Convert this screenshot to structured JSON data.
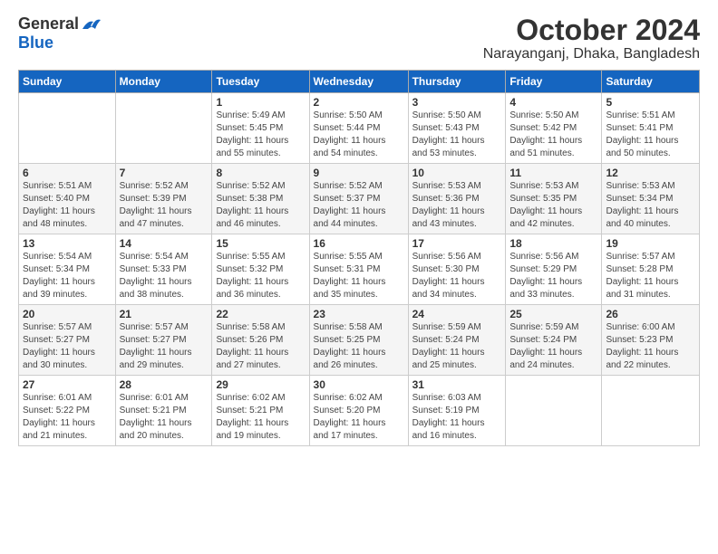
{
  "logo": {
    "general": "General",
    "blue": "Blue"
  },
  "title": "October 2024",
  "location": "Narayanganj, Dhaka, Bangladesh",
  "days_of_week": [
    "Sunday",
    "Monday",
    "Tuesday",
    "Wednesday",
    "Thursday",
    "Friday",
    "Saturday"
  ],
  "weeks": [
    [
      {
        "day": "",
        "info": ""
      },
      {
        "day": "",
        "info": ""
      },
      {
        "day": "1",
        "info": "Sunrise: 5:49 AM\nSunset: 5:45 PM\nDaylight: 11 hours\nand 55 minutes."
      },
      {
        "day": "2",
        "info": "Sunrise: 5:50 AM\nSunset: 5:44 PM\nDaylight: 11 hours\nand 54 minutes."
      },
      {
        "day": "3",
        "info": "Sunrise: 5:50 AM\nSunset: 5:43 PM\nDaylight: 11 hours\nand 53 minutes."
      },
      {
        "day": "4",
        "info": "Sunrise: 5:50 AM\nSunset: 5:42 PM\nDaylight: 11 hours\nand 51 minutes."
      },
      {
        "day": "5",
        "info": "Sunrise: 5:51 AM\nSunset: 5:41 PM\nDaylight: 11 hours\nand 50 minutes."
      }
    ],
    [
      {
        "day": "6",
        "info": "Sunrise: 5:51 AM\nSunset: 5:40 PM\nDaylight: 11 hours\nand 48 minutes."
      },
      {
        "day": "7",
        "info": "Sunrise: 5:52 AM\nSunset: 5:39 PM\nDaylight: 11 hours\nand 47 minutes."
      },
      {
        "day": "8",
        "info": "Sunrise: 5:52 AM\nSunset: 5:38 PM\nDaylight: 11 hours\nand 46 minutes."
      },
      {
        "day": "9",
        "info": "Sunrise: 5:52 AM\nSunset: 5:37 PM\nDaylight: 11 hours\nand 44 minutes."
      },
      {
        "day": "10",
        "info": "Sunrise: 5:53 AM\nSunset: 5:36 PM\nDaylight: 11 hours\nand 43 minutes."
      },
      {
        "day": "11",
        "info": "Sunrise: 5:53 AM\nSunset: 5:35 PM\nDaylight: 11 hours\nand 42 minutes."
      },
      {
        "day": "12",
        "info": "Sunrise: 5:53 AM\nSunset: 5:34 PM\nDaylight: 11 hours\nand 40 minutes."
      }
    ],
    [
      {
        "day": "13",
        "info": "Sunrise: 5:54 AM\nSunset: 5:34 PM\nDaylight: 11 hours\nand 39 minutes."
      },
      {
        "day": "14",
        "info": "Sunrise: 5:54 AM\nSunset: 5:33 PM\nDaylight: 11 hours\nand 38 minutes."
      },
      {
        "day": "15",
        "info": "Sunrise: 5:55 AM\nSunset: 5:32 PM\nDaylight: 11 hours\nand 36 minutes."
      },
      {
        "day": "16",
        "info": "Sunrise: 5:55 AM\nSunset: 5:31 PM\nDaylight: 11 hours\nand 35 minutes."
      },
      {
        "day": "17",
        "info": "Sunrise: 5:56 AM\nSunset: 5:30 PM\nDaylight: 11 hours\nand 34 minutes."
      },
      {
        "day": "18",
        "info": "Sunrise: 5:56 AM\nSunset: 5:29 PM\nDaylight: 11 hours\nand 33 minutes."
      },
      {
        "day": "19",
        "info": "Sunrise: 5:57 AM\nSunset: 5:28 PM\nDaylight: 11 hours\nand 31 minutes."
      }
    ],
    [
      {
        "day": "20",
        "info": "Sunrise: 5:57 AM\nSunset: 5:27 PM\nDaylight: 11 hours\nand 30 minutes."
      },
      {
        "day": "21",
        "info": "Sunrise: 5:57 AM\nSunset: 5:27 PM\nDaylight: 11 hours\nand 29 minutes."
      },
      {
        "day": "22",
        "info": "Sunrise: 5:58 AM\nSunset: 5:26 PM\nDaylight: 11 hours\nand 27 minutes."
      },
      {
        "day": "23",
        "info": "Sunrise: 5:58 AM\nSunset: 5:25 PM\nDaylight: 11 hours\nand 26 minutes."
      },
      {
        "day": "24",
        "info": "Sunrise: 5:59 AM\nSunset: 5:24 PM\nDaylight: 11 hours\nand 25 minutes."
      },
      {
        "day": "25",
        "info": "Sunrise: 5:59 AM\nSunset: 5:24 PM\nDaylight: 11 hours\nand 24 minutes."
      },
      {
        "day": "26",
        "info": "Sunrise: 6:00 AM\nSunset: 5:23 PM\nDaylight: 11 hours\nand 22 minutes."
      }
    ],
    [
      {
        "day": "27",
        "info": "Sunrise: 6:01 AM\nSunset: 5:22 PM\nDaylight: 11 hours\nand 21 minutes."
      },
      {
        "day": "28",
        "info": "Sunrise: 6:01 AM\nSunset: 5:21 PM\nDaylight: 11 hours\nand 20 minutes."
      },
      {
        "day": "29",
        "info": "Sunrise: 6:02 AM\nSunset: 5:21 PM\nDaylight: 11 hours\nand 19 minutes."
      },
      {
        "day": "30",
        "info": "Sunrise: 6:02 AM\nSunset: 5:20 PM\nDaylight: 11 hours\nand 17 minutes."
      },
      {
        "day": "31",
        "info": "Sunrise: 6:03 AM\nSunset: 5:19 PM\nDaylight: 11 hours\nand 16 minutes."
      },
      {
        "day": "",
        "info": ""
      },
      {
        "day": "",
        "info": ""
      }
    ]
  ]
}
